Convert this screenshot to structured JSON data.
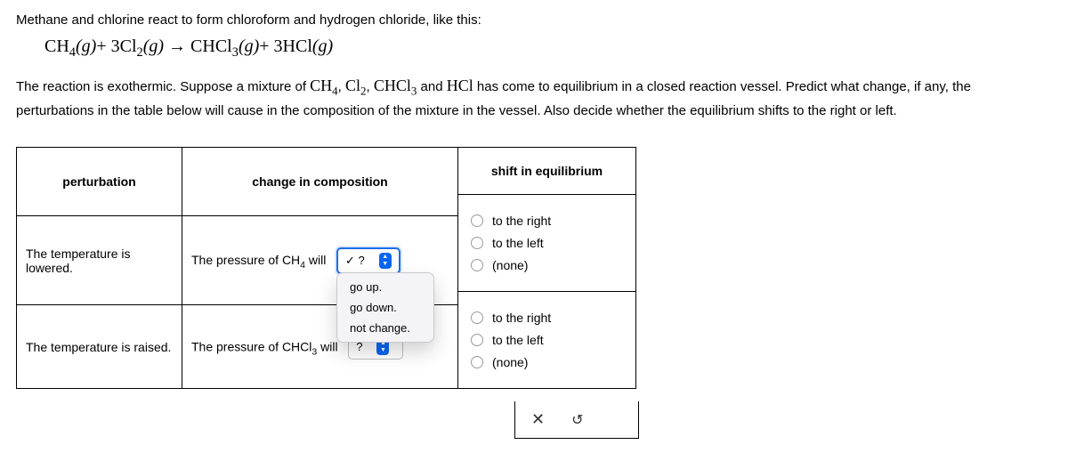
{
  "intro_text": "Methane and chlorine react to form chloroform and hydrogen chloride, like this:",
  "equation": {
    "lhs1": "CH",
    "lhs1_sub": "4",
    "lhs1_phase": "(g)",
    "plus1": "+",
    "lhs2_coeff": "3",
    "lhs2": "Cl",
    "lhs2_sub": "2",
    "lhs2_phase": "(g)",
    "arrow": "→",
    "rhs1": "CHCl",
    "rhs1_sub": "3",
    "rhs1_phase": "(g)",
    "plus2": "+",
    "rhs2_coeff": "3",
    "rhs2": "HCl",
    "rhs2_phase": "(g)"
  },
  "desc_part1": "The reaction is exothermic. Suppose a mixture of ",
  "chem1": "CH",
  "chem1_sub": "4",
  "comma1": ", ",
  "chem2": "Cl",
  "chem2_sub": "2",
  "comma2": ", ",
  "chem3": "CHCl",
  "chem3_sub": "3",
  "and_word": " and ",
  "chem4": "HCl",
  "desc_part2": " has come to equilibrium in a closed reaction vessel. Predict what change, if any, the perturbations in the table below will cause in the composition of the mixture in the vessel. Also decide whether the equilibrium shifts to the right or left.",
  "table": {
    "headers": {
      "perturbation": "perturbation",
      "change": "change in composition"
    },
    "row1": {
      "perturbation": "The temperature is lowered.",
      "change_prefix": "The pressure of CH",
      "change_sub": "4",
      "change_suffix": " will",
      "select_value": "✓ ?"
    },
    "row2": {
      "perturbation": "The temperature is raised.",
      "change_prefix": "The pressure of CHCl",
      "change_sub": "3",
      "change_suffix": " will",
      "select_value": "?"
    }
  },
  "dropdown": {
    "opt1": "go up.",
    "opt2": "go down.",
    "opt3": "not change."
  },
  "shift": {
    "header": "shift in equilibrium",
    "opt_right": "to the right",
    "opt_left": "to the left",
    "opt_none": "(none)"
  },
  "icons": {
    "close": "✕",
    "undo": "↺"
  }
}
